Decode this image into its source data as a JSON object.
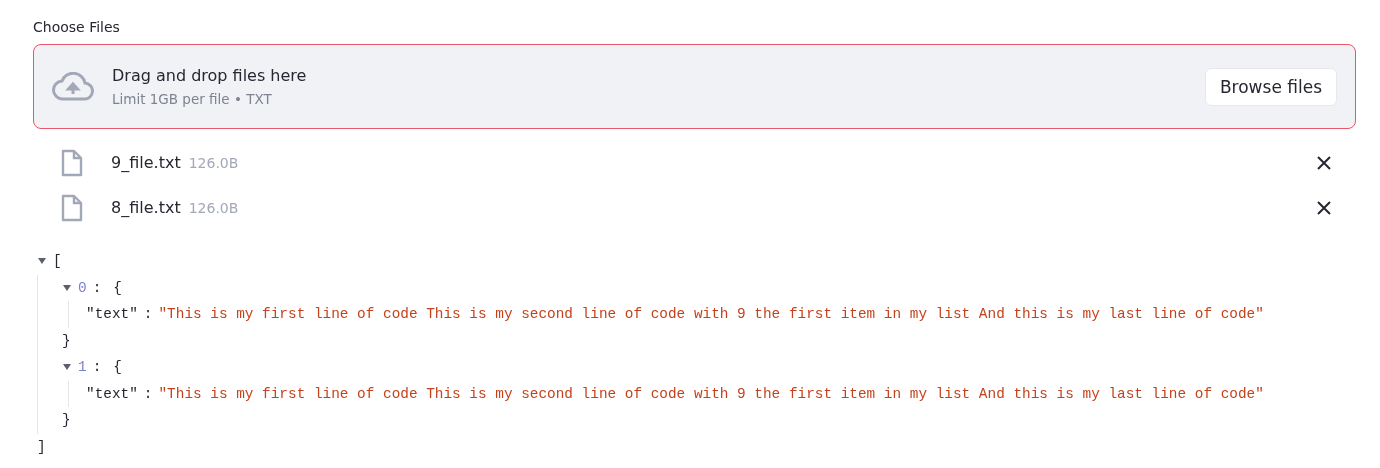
{
  "uploader": {
    "label": "Choose Files",
    "dropzone_title": "Drag and drop files here",
    "dropzone_hint": "Limit 1GB per file • TXT",
    "button": "Browse files",
    "highlighted": true
  },
  "files": [
    {
      "name": "9_file.txt",
      "size": "126.0B"
    },
    {
      "name": "8_file.txt",
      "size": "126.0B"
    }
  ],
  "json_view": {
    "open": "[",
    "close": "]",
    "expanded": true,
    "items": [
      {
        "index": "0",
        "index_separator": ":",
        "open": "{",
        "close": "}",
        "expanded": true,
        "key": "\"text\"",
        "key_separator": ":",
        "value": "\"This is my first line of code This is my second line of code with 9 the first item in my list And this is my last line of code\""
      },
      {
        "index": "1",
        "index_separator": ":",
        "open": "{",
        "close": "}",
        "expanded": true,
        "key": "\"text\"",
        "key_separator": ":",
        "value": "\"This is my first line of code This is my second line of code with 9 the first item in my list And this is my last line of code\""
      }
    ]
  }
}
